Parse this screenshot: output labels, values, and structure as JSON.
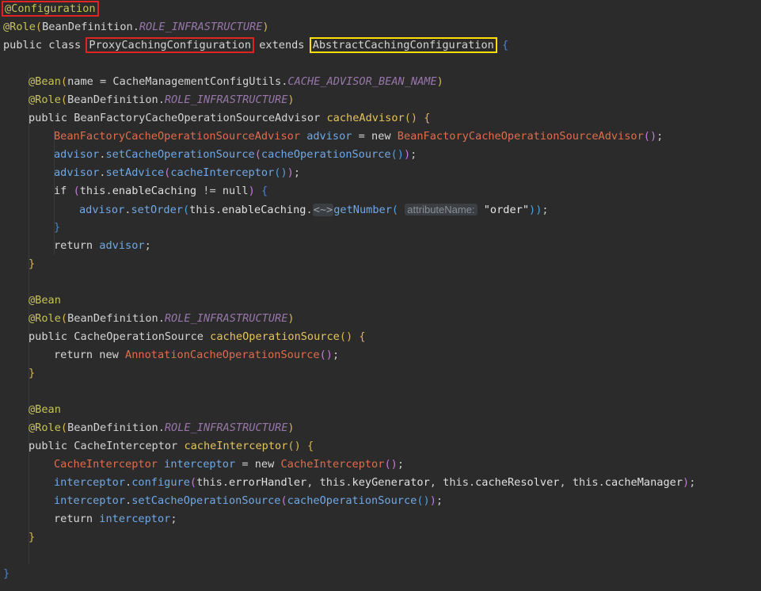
{
  "code": {
    "annotation_configuration": "@Configuration",
    "annotation_role": "@Role",
    "annotation_bean": "@Bean",
    "bean_definition": "BeanDefinition",
    "role_infrastructure": "ROLE_INFRASTRUCTURE",
    "kw_public": "public",
    "kw_class": "class",
    "kw_extends": "extends",
    "kw_new": "new",
    "kw_return": "return",
    "kw_if": "if",
    "kw_this": "this",
    "kw_null": "null",
    "class_name": "ProxyCachingConfiguration",
    "super_class": "AbstractCachingConfiguration",
    "bean_name_param": "name",
    "config_utils": "CacheManagementConfigUtils",
    "advisor_bean_name": "CACHE_ADVISOR_BEAN_NAME",
    "advisor_type": "BeanFactoryCacheOperationSourceAdvisor",
    "cache_advisor_method": "cacheAdvisor",
    "advisor_var": "advisor",
    "set_cache_op_source": "setCacheOperationSource",
    "cache_op_source_call": "cacheOperationSource",
    "set_advice": "setAdvice",
    "cache_interceptor_call": "cacheInterceptor",
    "enable_caching": "enableCaching",
    "not_equal": "!=",
    "set_order": "setOrder",
    "fold_marker": "<~>",
    "get_number": "getNumber",
    "param_hint": "attributeName:",
    "order_string": "\"order\"",
    "cache_op_source_type": "CacheOperationSource",
    "cache_op_source_method": "cacheOperationSource",
    "annotation_cache_op_source": "AnnotationCacheOperationSource",
    "cache_interceptor_type": "CacheInterceptor",
    "cache_interceptor_method": "cacheInterceptor",
    "interceptor_var": "interceptor",
    "configure": "configure",
    "error_handler": "errorHandler",
    "key_generator": "keyGenerator",
    "cache_resolver": "cacheResolver",
    "cache_manager": "cacheManager"
  },
  "colors": {
    "background": "#2b2b2b",
    "annotation": "#c7c35a",
    "constant": "#9876aa",
    "variable": "#70a8e6",
    "constructor": "#e06c4e",
    "box_red": "#e02424",
    "box_yellow": "#ffdf00"
  }
}
